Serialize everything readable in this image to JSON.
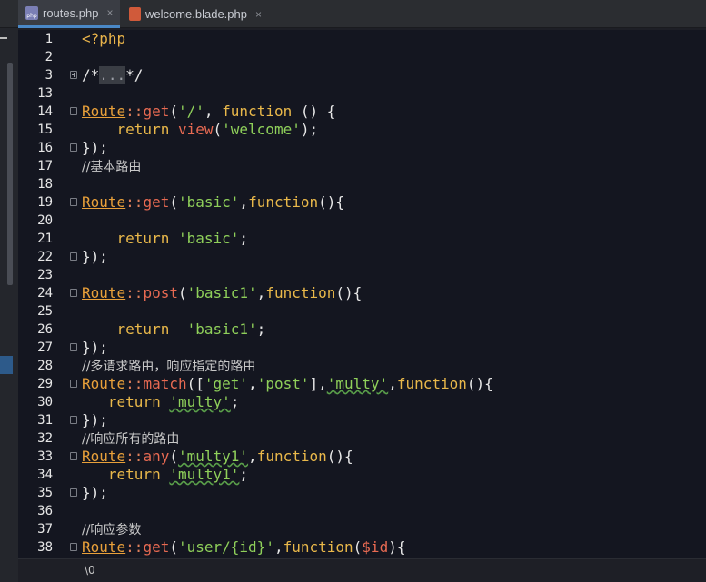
{
  "tabs": [
    {
      "label": "routes.php",
      "icon": "php-file-icon",
      "icon_text": "php",
      "close": "×",
      "active": true
    },
    {
      "label": "welcome.blade.php",
      "icon": "blade-file-icon",
      "icon_text": "",
      "close": "×",
      "active": false
    }
  ],
  "lines": [
    {
      "n": "1",
      "fold": null,
      "tokens": [
        [
          "t-tag",
          "<?php"
        ]
      ]
    },
    {
      "n": "2",
      "fold": null,
      "tokens": []
    },
    {
      "n": "3",
      "fold": "plus",
      "tokens": [
        [
          "t-plain",
          "/*"
        ],
        [
          "t-fold",
          "..."
        ],
        [
          "t-plain",
          "*/"
        ]
      ]
    },
    {
      "n": "13",
      "fold": null,
      "tokens": []
    },
    {
      "n": "14",
      "fold": "open",
      "tokens": [
        [
          "t-class",
          "Route"
        ],
        [
          "t-op",
          "::"
        ],
        [
          "t-method",
          "get"
        ],
        [
          "t-plain",
          "("
        ],
        [
          "t-str",
          "'/'"
        ],
        [
          "t-plain",
          ", "
        ],
        [
          "t-kw",
          "function"
        ],
        [
          "t-plain",
          " () {"
        ]
      ]
    },
    {
      "n": "15",
      "fold": null,
      "tokens": [
        [
          "t-plain",
          "    "
        ],
        [
          "t-kw",
          "return"
        ],
        [
          "t-plain",
          " "
        ],
        [
          "t-method",
          "view"
        ],
        [
          "t-plain",
          "("
        ],
        [
          "t-str",
          "'welcome'"
        ],
        [
          "t-plain",
          ");"
        ]
      ]
    },
    {
      "n": "16",
      "fold": "close",
      "tokens": [
        [
          "t-plain",
          "});"
        ]
      ]
    },
    {
      "n": "17",
      "fold": null,
      "tokens": [
        [
          "t-comment",
          "//基本路由"
        ]
      ]
    },
    {
      "n": "18",
      "fold": null,
      "tokens": []
    },
    {
      "n": "19",
      "fold": "open",
      "tokens": [
        [
          "t-class",
          "Route"
        ],
        [
          "t-op",
          "::"
        ],
        [
          "t-method",
          "get"
        ],
        [
          "t-plain",
          "("
        ],
        [
          "t-str",
          "'basic'"
        ],
        [
          "t-plain",
          ","
        ],
        [
          "t-kw",
          "function"
        ],
        [
          "t-plain",
          "(){"
        ]
      ]
    },
    {
      "n": "20",
      "fold": null,
      "tokens": []
    },
    {
      "n": "21",
      "fold": null,
      "tokens": [
        [
          "t-plain",
          "    "
        ],
        [
          "t-kw",
          "return"
        ],
        [
          "t-plain",
          " "
        ],
        [
          "t-str",
          "'basic'"
        ],
        [
          "t-plain",
          ";"
        ]
      ]
    },
    {
      "n": "22",
      "fold": "close",
      "tokens": [
        [
          "t-plain",
          "});"
        ]
      ]
    },
    {
      "n": "23",
      "fold": null,
      "tokens": []
    },
    {
      "n": "24",
      "fold": "open",
      "tokens": [
        [
          "t-class",
          "Route"
        ],
        [
          "t-op",
          "::"
        ],
        [
          "t-method",
          "post"
        ],
        [
          "t-plain",
          "("
        ],
        [
          "t-str",
          "'basic1'"
        ],
        [
          "t-plain",
          ","
        ],
        [
          "t-kw",
          "function"
        ],
        [
          "t-plain",
          "(){"
        ]
      ]
    },
    {
      "n": "25",
      "fold": null,
      "tokens": []
    },
    {
      "n": "26",
      "fold": null,
      "tokens": [
        [
          "t-plain",
          "    "
        ],
        [
          "t-kw",
          "return"
        ],
        [
          "t-plain",
          "  "
        ],
        [
          "t-str",
          "'basic1'"
        ],
        [
          "t-plain",
          ";"
        ]
      ]
    },
    {
      "n": "27",
      "fold": "close",
      "tokens": [
        [
          "t-plain",
          "});"
        ]
      ]
    },
    {
      "n": "28",
      "fold": null,
      "tokens": [
        [
          "t-comment",
          "//多请求路由，响应指定的路由"
        ]
      ]
    },
    {
      "n": "29",
      "fold": "open",
      "tokens": [
        [
          "t-class",
          "Route"
        ],
        [
          "t-op",
          "::"
        ],
        [
          "t-method",
          "match"
        ],
        [
          "t-plain",
          "(["
        ],
        [
          "t-str",
          "'get'"
        ],
        [
          "t-plain",
          ","
        ],
        [
          "t-str",
          "'post'"
        ],
        [
          "t-plain",
          "],"
        ],
        [
          "t-str wavy",
          "'multy'"
        ],
        [
          "t-plain",
          ","
        ],
        [
          "t-kw",
          "function"
        ],
        [
          "t-plain",
          "(){"
        ]
      ]
    },
    {
      "n": "30",
      "fold": null,
      "tokens": [
        [
          "t-plain",
          "   "
        ],
        [
          "t-kw",
          "return"
        ],
        [
          "t-plain",
          " "
        ],
        [
          "t-str wavy",
          "'multy'"
        ],
        [
          "t-plain",
          ";"
        ]
      ]
    },
    {
      "n": "31",
      "fold": "close",
      "tokens": [
        [
          "t-plain",
          "});"
        ]
      ]
    },
    {
      "n": "32",
      "fold": null,
      "tokens": [
        [
          "t-comment",
          "//响应所有的路由"
        ]
      ]
    },
    {
      "n": "33",
      "fold": "open",
      "tokens": [
        [
          "t-class",
          "Route"
        ],
        [
          "t-op",
          "::"
        ],
        [
          "t-method",
          "any"
        ],
        [
          "t-plain",
          "("
        ],
        [
          "t-str wavy",
          "'multy1'"
        ],
        [
          "t-plain",
          ","
        ],
        [
          "t-kw",
          "function"
        ],
        [
          "t-plain",
          "(){"
        ]
      ]
    },
    {
      "n": "34",
      "fold": null,
      "tokens": [
        [
          "t-plain",
          "   "
        ],
        [
          "t-kw",
          "return"
        ],
        [
          "t-plain",
          " "
        ],
        [
          "t-str wavy",
          "'multy1'"
        ],
        [
          "t-plain",
          ";"
        ]
      ]
    },
    {
      "n": "35",
      "fold": "close",
      "tokens": [
        [
          "t-plain",
          "});"
        ]
      ]
    },
    {
      "n": "36",
      "fold": null,
      "tokens": []
    },
    {
      "n": "37",
      "fold": null,
      "tokens": [
        [
          "t-comment",
          "//响应参数"
        ]
      ]
    },
    {
      "n": "38",
      "fold": "open",
      "tokens": [
        [
          "t-class",
          "Route"
        ],
        [
          "t-op",
          "::"
        ],
        [
          "t-method",
          "get"
        ],
        [
          "t-plain",
          "("
        ],
        [
          "t-str",
          "'user/{id}'"
        ],
        [
          "t-plain",
          ","
        ],
        [
          "t-kw",
          "function"
        ],
        [
          "t-plain",
          "("
        ],
        [
          "t-var",
          "$id"
        ],
        [
          "t-plain",
          "){"
        ]
      ]
    }
  ],
  "status": {
    "text": "\\0"
  }
}
